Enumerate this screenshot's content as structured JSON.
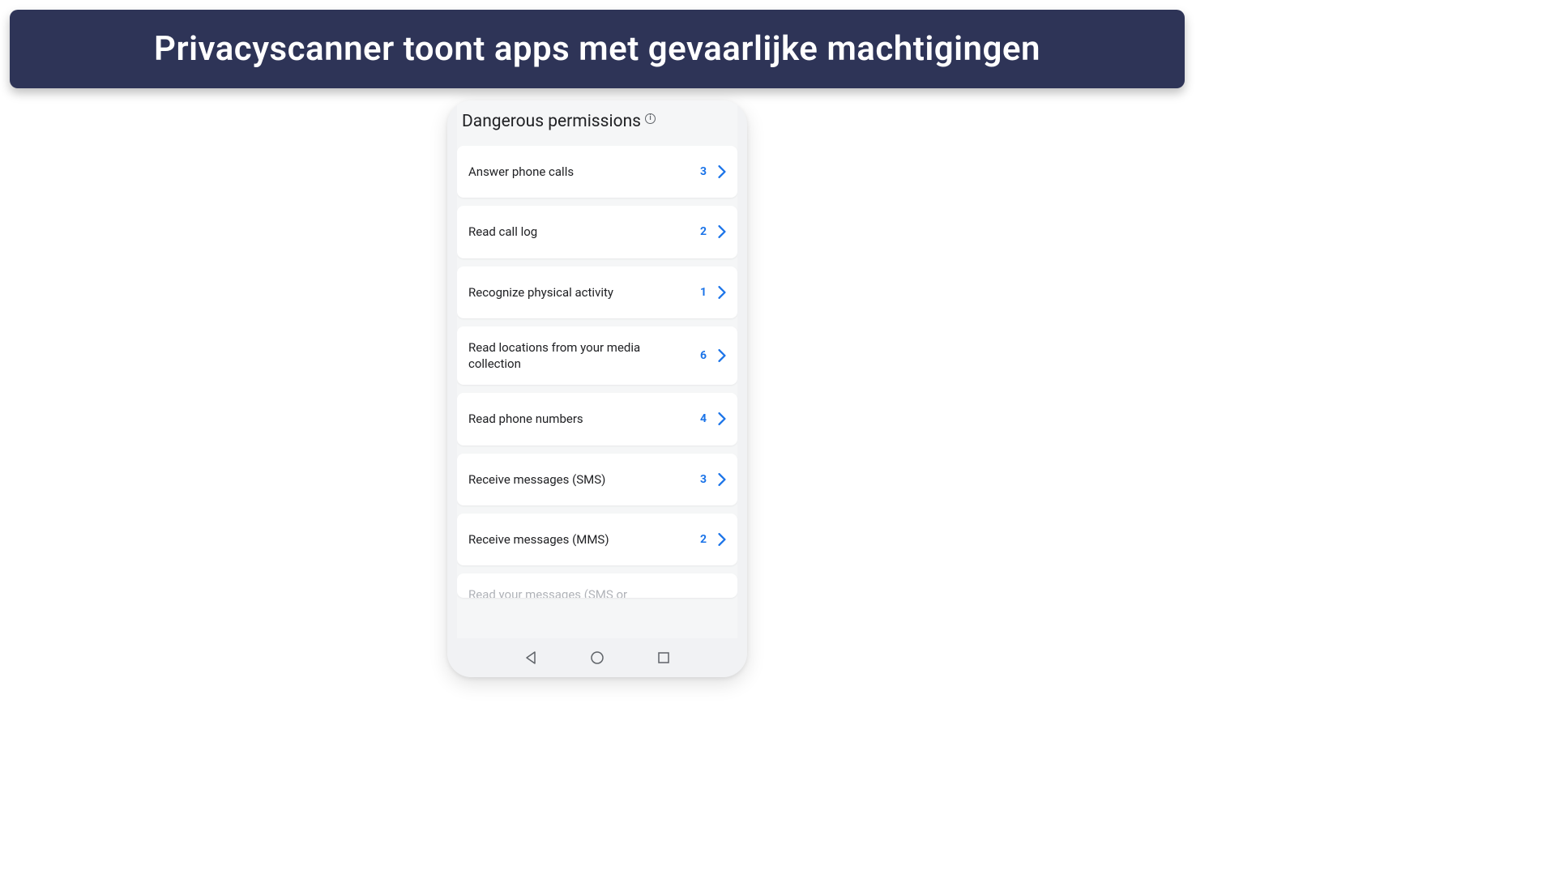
{
  "banner": {
    "title": "Privacyscanner toont apps met gevaarlijke machtigingen"
  },
  "screen": {
    "section_title": "Dangerous permissions",
    "info_symbol": "i",
    "permissions": [
      {
        "label": "Answer phone calls",
        "count": "3"
      },
      {
        "label": "Read call log",
        "count": "2"
      },
      {
        "label": "Recognize physical activity",
        "count": "1"
      },
      {
        "label": "Read locations from your media collection",
        "count": "6"
      },
      {
        "label": "Read phone numbers",
        "count": "4"
      },
      {
        "label": "Receive messages (SMS)",
        "count": "3"
      },
      {
        "label": "Receive messages (MMS)",
        "count": "2"
      }
    ],
    "partial_permission_label": "Read your messages (SMS or"
  },
  "colors": {
    "banner_bg": "#2e3457",
    "accent": "#1a73e8"
  }
}
